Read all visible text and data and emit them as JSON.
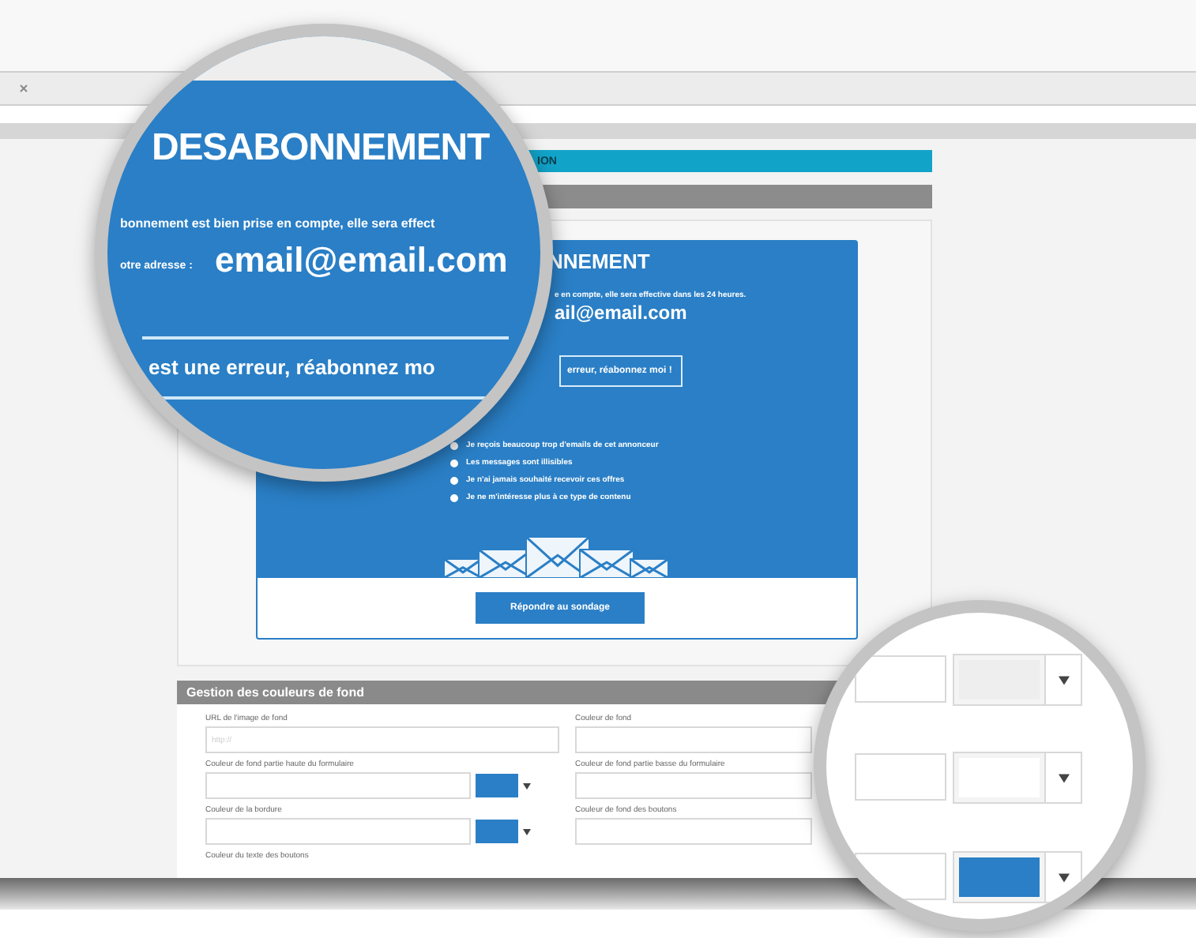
{
  "section_bar": {
    "title": "ION"
  },
  "card": {
    "title": "NNEMENT",
    "message": "e en compte, elle sera effective dans les 24 heures.",
    "email": "ail@email.com",
    "resubscribe_button": "erreur, réabonnez moi !",
    "reasons": [
      {
        "label": "Je reçois beaucoup trop d'emails de cet annonceur",
        "checked": false
      },
      {
        "label": "Les messages sont illisibles",
        "checked": false
      },
      {
        "label": "Je n'ai jamais souhaité recevoir ces offres",
        "checked": false
      },
      {
        "label": "Je ne m'intéresse plus à ce type de contenu",
        "checked": false
      }
    ],
    "survey_button": "Répondre au sondage"
  },
  "colors_panel": {
    "title": "Gestion des couleurs de fond",
    "fields": [
      {
        "label": "URL de l'image de fond",
        "kind": "text",
        "placeholder": "http://"
      },
      {
        "label": "Couleur de fond",
        "kind": "text"
      },
      {
        "label": "Couleur de fond partie haute du formulaire",
        "kind": "color",
        "color": "#2a7fc6"
      },
      {
        "label": "Couleur de fond partie basse du formulaire",
        "kind": "text"
      },
      {
        "label": "Couleur de la bordure",
        "kind": "color",
        "color": "#2a7fc6"
      },
      {
        "label": "Couleur de fond des boutons",
        "kind": "text"
      },
      {
        "label": "Couleur du texte des boutons",
        "kind": "label"
      }
    ]
  },
  "magnifier_top": {
    "title": "DESABONNEMENT",
    "message": "bonnement est bien prise en compte, elle sera effect",
    "address_label": "otre adresse :",
    "email": "email@email.com",
    "resubscribe_button": "est une erreur, réabonnez mo"
  },
  "magnifier_bottom": {
    "rows": [
      {
        "color": "#eeeeee"
      },
      {
        "color": "#ffffff"
      },
      {
        "color": "#2a7fc6"
      }
    ]
  }
}
